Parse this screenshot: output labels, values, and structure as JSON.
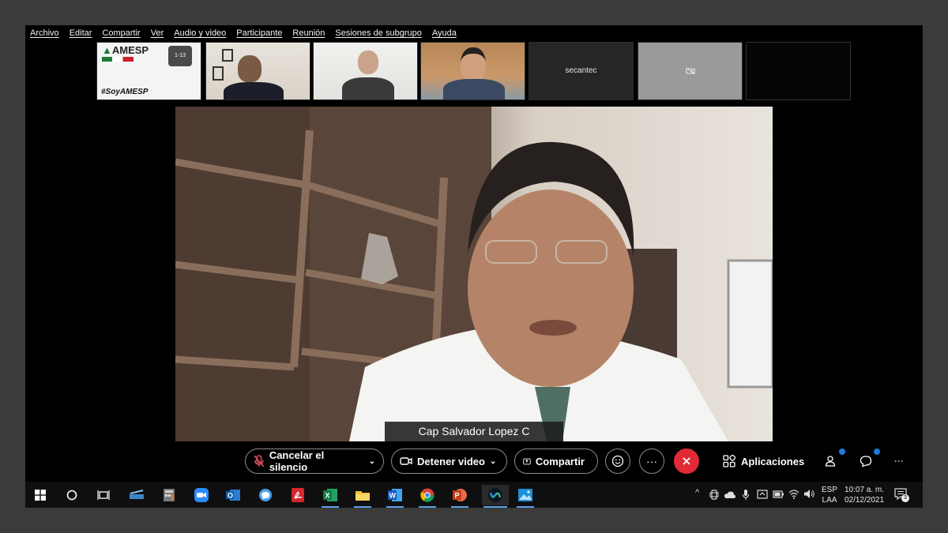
{
  "menu": [
    "Archivo",
    "Editar",
    "Compartir",
    "Ver",
    "Audio y video",
    "Participante",
    "Reunión",
    "Sesiones de subgrupo",
    "Ayuda"
  ],
  "thumbnails": {
    "amesp_logo_text": "AMESP",
    "amesp_badge": "1-13",
    "hashtag": "#SoyAMESP",
    "secantec_name": "secantec"
  },
  "speaker": {
    "name": "Cap Salvador Lopez C"
  },
  "controls": {
    "mute_label": "Cancelar el silencio",
    "video_label": "Detener video",
    "share_label": "Compartir",
    "apps_label": "Aplicaciones"
  },
  "tray": {
    "lang": "ESP",
    "layout": "LAA",
    "time": "10:07 a. m.",
    "date": "02/12/2021",
    "notifications": "3"
  },
  "colors": {
    "leave": "#e02b36",
    "badge_dot": "#1b7bd8",
    "window_bg": "#000000",
    "outer_bg": "#3b3b3b"
  }
}
